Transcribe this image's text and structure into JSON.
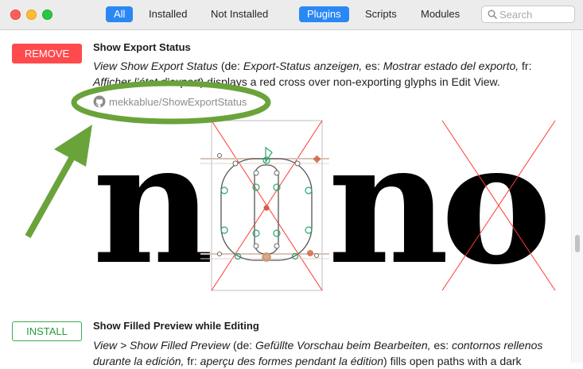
{
  "toolbar": {
    "filters": [
      "All",
      "Installed",
      "Not Installed"
    ],
    "types": [
      "Plugins",
      "Scripts",
      "Modules"
    ],
    "search_placeholder": "Search",
    "active_filter": "All",
    "active_type": "Plugins"
  },
  "items": [
    {
      "button": "REMOVE",
      "title": "Show Export Status",
      "description": {
        "t1": "View Show Export Status",
        "t2": " (de: ",
        "t3": "Export-Status anzeigen,",
        "t4": " es: ",
        "t5": "Mostrar estado del exporto,",
        "t6": " fr: ",
        "t7": "Afficher l’état d’export",
        "t8": ") displays a red cross over non-exporting glyphs in Edit View."
      },
      "repo": "mekkablue/ShowExportStatus",
      "preview_glyphs": [
        "n",
        "o",
        "n",
        "o"
      ]
    },
    {
      "button": "INSTALL",
      "title": "Show Filled Preview while Editing",
      "description": {
        "t1": "View > Show Filled Preview",
        "t2": " (de: ",
        "t3": "Gefüllte Vorschau beim Bearbeiten,",
        "t4": " es: ",
        "t5": "contornos rellenos durante la edición,",
        "t6": " fr: ",
        "t7": "aperçu des formes pendant la édition",
        "t8": ") fills open paths with a dark"
      }
    }
  ],
  "colors": {
    "accent": "#2a88f4",
    "remove": "#ff4a4d",
    "install": "#3bab50",
    "annotation": "#6aa33a",
    "cross": "#ff3b30"
  }
}
